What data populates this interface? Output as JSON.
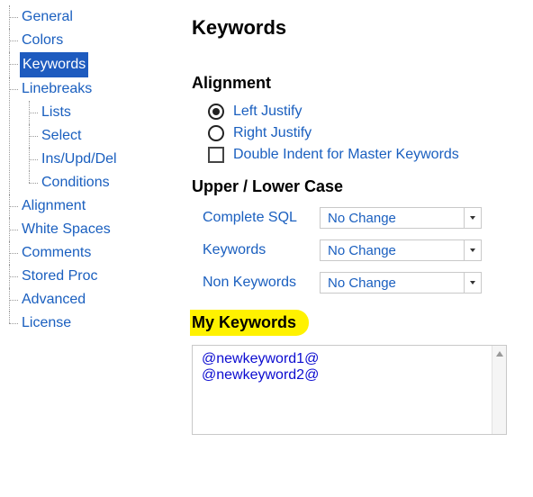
{
  "sidebar": {
    "items": [
      {
        "label": "General",
        "selected": false
      },
      {
        "label": "Colors",
        "selected": false
      },
      {
        "label": "Keywords",
        "selected": true
      },
      {
        "label": "Linebreaks",
        "selected": false,
        "children": [
          {
            "label": "Lists"
          },
          {
            "label": "Select"
          },
          {
            "label": "Ins/Upd/Del"
          },
          {
            "label": "Conditions"
          }
        ]
      },
      {
        "label": "Alignment",
        "selected": false
      },
      {
        "label": "White Spaces",
        "selected": false
      },
      {
        "label": "Comments",
        "selected": false
      },
      {
        "label": "Stored Proc",
        "selected": false
      },
      {
        "label": "Advanced",
        "selected": false
      },
      {
        "label": "License",
        "selected": false
      }
    ]
  },
  "main": {
    "title": "Keywords",
    "alignment": {
      "heading": "Alignment",
      "left_label": "Left Justify",
      "right_label": "Right Justify",
      "left_selected": true,
      "right_selected": false,
      "double_indent_label": "Double Indent for Master Keywords",
      "double_indent_checked": false
    },
    "case": {
      "heading": "Upper / Lower Case",
      "rows": [
        {
          "label": "Complete SQL",
          "value": "No Change"
        },
        {
          "label": "Keywords",
          "value": "No Change"
        },
        {
          "label": "Non Keywords",
          "value": "No Change"
        }
      ]
    },
    "mykeywords": {
      "heading": "My Keywords",
      "content": "@newkeyword1@\n@newkeyword2@"
    }
  }
}
